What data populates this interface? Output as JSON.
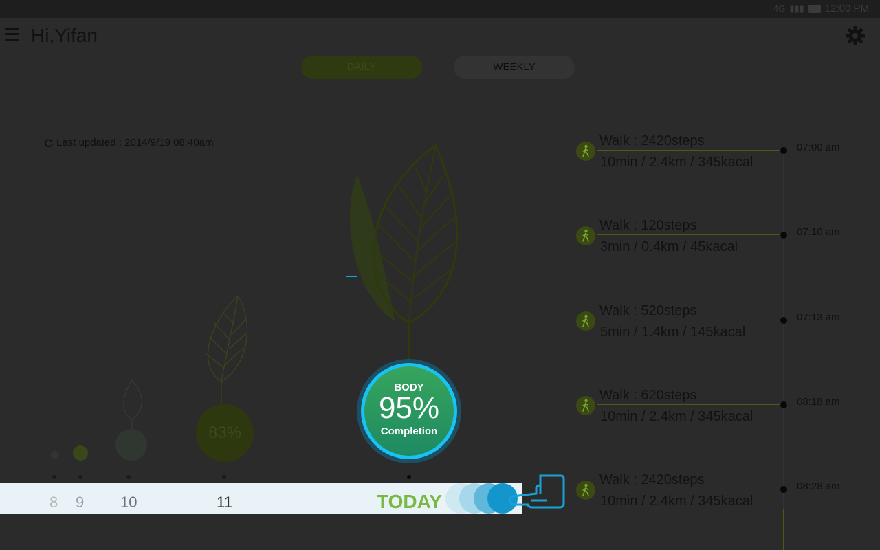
{
  "status_bar": {
    "time": "12:00 PM",
    "network": "4G"
  },
  "header": {
    "title": "Hi,Yifan",
    "menu_icon": "hamburger-menu-icon",
    "settings_icon": "gear-icon"
  },
  "tabs": [
    {
      "label": "DAILY",
      "selected": true
    },
    {
      "label": "WEEKLY",
      "selected": false
    }
  ],
  "last_updated": "Last updated : 2014/9/19 08:40am",
  "history": [
    {
      "day": "8",
      "value": ""
    },
    {
      "day": "9",
      "value": ""
    },
    {
      "day": "10",
      "value": ""
    },
    {
      "day": "11",
      "value": "83%"
    }
  ],
  "today": {
    "label": "TODAY",
    "category": "BODY",
    "percent": "95%",
    "percent_value": 95,
    "caption": "Completion"
  },
  "activities": [
    {
      "title": "Walk : 2420steps",
      "detail": "10min / 2.4km / 345kacal",
      "time": "07:00 am"
    },
    {
      "title": "Walk : 120steps",
      "detail": "3min / 0.4km / 45kacal",
      "time": "07:10 am"
    },
    {
      "title": "Walk : 520steps",
      "detail": "5min / 1.4km / 145kacal",
      "time": "07:13 am"
    },
    {
      "title": "Walk : 620steps",
      "detail": "10min / 2.4km / 345kacal",
      "time": "08:18 am"
    },
    {
      "title": "Walk : 2420steps",
      "detail": "10min / 2.4km / 345kacal",
      "time": "08:28 am"
    }
  ],
  "colors": {
    "accent_green": "#79b843",
    "accent_blue": "#18c2f2",
    "dim_overlay": "#2b2b2b"
  }
}
